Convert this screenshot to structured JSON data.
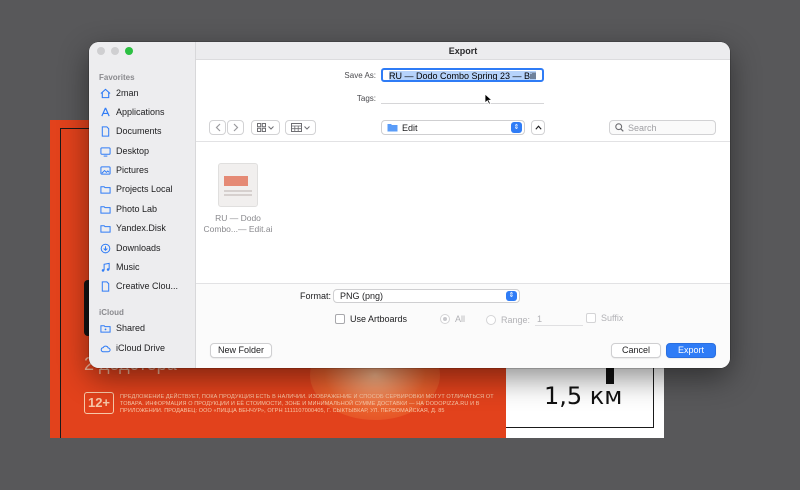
{
  "background_artwork": {
    "distance_text": "1,5 км",
    "ghost_text": "2 додстера",
    "age_badge": "12+",
    "disclaimer": "ПРЕДЛОЖЕНИЕ ДЕЙСТВУЕТ, ПОКА ПРОДУКЦИЯ ЕСТЬ В НАЛИЧИИ. ИЗОБРАЖЕНИЕ И СПОСОБ СЕРВИРОВКИ МОГУТ ОТЛИЧАТЬСЯ ОТ ТОВАРА. ИНФОРМАЦИЯ О ПРОДУКЦИИ И ЕЁ СТОИМОСТИ, ЗОНЕ И МИНИМАЛЬНОЙ СУММЕ ДОСТАВКИ — НА DODOPIZZA.RU И В ПРИЛОЖЕНИИ. ПРОДАВЕЦ: ООО «ПИЦЦА ВЕНЧУР», ОГРН 1111107000405, Г. СЫКТЫВКАР, УЛ. ПЕРВОМАЙСКАЯ, Д. 85"
  },
  "dialog": {
    "title": "Export",
    "save_as_label": "Save As:",
    "save_as_value": "RU — Dodo Combo Spring 23 — Bill",
    "tags_label": "Tags:",
    "location": "Edit",
    "search_placeholder": "Search",
    "format_label": "Format:",
    "format_value": "PNG (png)",
    "use_artboards_label": "Use Artboards",
    "all_label": "All",
    "range_label": "Range:",
    "range_value": "1",
    "suffix_label": "Suffix",
    "new_folder_label": "New Folder",
    "cancel_label": "Cancel",
    "export_label": "Export"
  },
  "sidebar": {
    "favorites_header": "Favorites",
    "icloud_header": "iCloud",
    "favorites": [
      {
        "label": "2man",
        "icon": "home-icon"
      },
      {
        "label": "Applications",
        "icon": "applications-icon"
      },
      {
        "label": "Documents",
        "icon": "document-icon"
      },
      {
        "label": "Desktop",
        "icon": "desktop-icon"
      },
      {
        "label": "Pictures",
        "icon": "pictures-icon"
      },
      {
        "label": "Projects Local",
        "icon": "folder-icon"
      },
      {
        "label": "Photo Lab",
        "icon": "folder-icon"
      },
      {
        "label": "Yandex.Disk",
        "icon": "folder-icon"
      },
      {
        "label": "Downloads",
        "icon": "downloads-icon"
      },
      {
        "label": "Music",
        "icon": "music-icon"
      },
      {
        "label": "Creative Clou...",
        "icon": "document-icon"
      }
    ],
    "icloud": [
      {
        "label": "Shared",
        "icon": "shared-folder-icon"
      },
      {
        "label": "iCloud Drive",
        "icon": "cloud-icon"
      }
    ]
  },
  "files": [
    {
      "name_line1": "RU — Dodo",
      "name_line2": "Combo...— Edit.ai"
    }
  ],
  "colors": {
    "accent": "#2f7cf6",
    "artwork_orange": "#e2421c",
    "traffic_green": "#2cc042"
  }
}
